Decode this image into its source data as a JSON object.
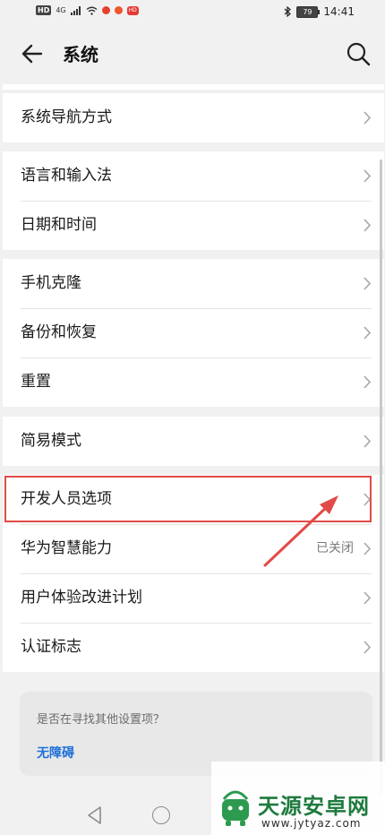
{
  "status_bar": {
    "hd_label": "HD",
    "signal_label": "4G",
    "badge_label": "HD",
    "battery": "79",
    "time": "14:41"
  },
  "header": {
    "title": "系统"
  },
  "groups": [
    {
      "items": [
        {
          "label": "系统导航方式"
        }
      ]
    },
    {
      "items": [
        {
          "label": "语言和输入法"
        },
        {
          "label": "日期和时间"
        }
      ]
    },
    {
      "items": [
        {
          "label": "手机克隆"
        },
        {
          "label": "备份和恢复"
        },
        {
          "label": "重置"
        }
      ]
    },
    {
      "items": [
        {
          "label": "简易模式"
        }
      ]
    },
    {
      "items": [
        {
          "label": "开发人员选项"
        },
        {
          "label": "华为智慧能力",
          "status": "已关闭"
        },
        {
          "label": "用户体验改进计划"
        },
        {
          "label": "认证标志"
        }
      ]
    }
  ],
  "suggestion": {
    "question": "是否在寻找其他设置项？",
    "link": "无障碍"
  },
  "watermark": {
    "title": "天源安卓网",
    "url": "www.jytyaz.com"
  },
  "colors": {
    "background": "#f1f1f1",
    "card": "#ffffff",
    "annotation_red": "#e24a47",
    "link_blue": "#1f6fd8",
    "watermark_green": "#1e7a3e"
  }
}
